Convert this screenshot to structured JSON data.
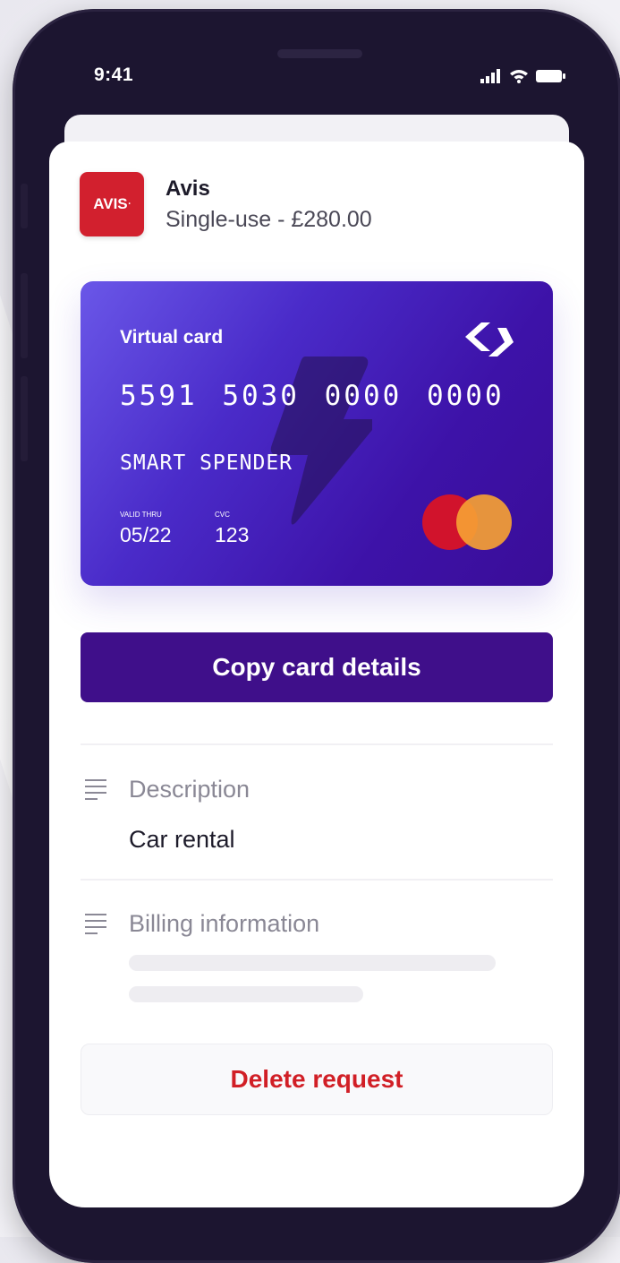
{
  "status_bar": {
    "time": "9:41"
  },
  "merchant": {
    "logo_text": "AVIS",
    "name": "Avis",
    "subtitle": "Single-use - £280.00"
  },
  "card": {
    "label": "Virtual card",
    "number": "5591 5030 0000 0000",
    "holder": "SMART SPENDER",
    "valid_label": "VALID THRU",
    "valid": "05/22",
    "cvc_label": "CVC",
    "cvc": "123"
  },
  "actions": {
    "copy": "Copy card details",
    "delete": "Delete request"
  },
  "description": {
    "title": "Description",
    "value": "Car rental"
  },
  "billing": {
    "title": "Billing information"
  },
  "colors": {
    "primary": "#3f0f8a",
    "danger": "#d11f26",
    "brand_red": "#d2202e"
  }
}
